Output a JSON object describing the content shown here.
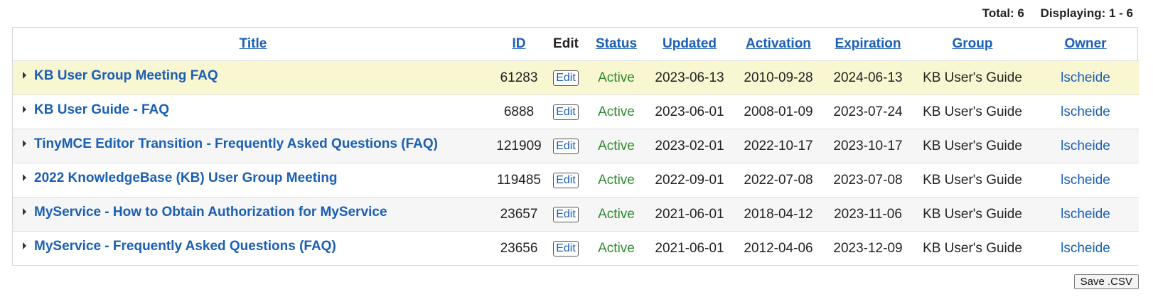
{
  "summary": {
    "total": "Total: 6",
    "displaying": "Displaying: 1 - 6"
  },
  "columns": {
    "title": "Title",
    "id": "ID",
    "edit": "Edit",
    "status": "Status",
    "updated": "Updated",
    "activation": "Activation",
    "expiration": "Expiration",
    "group": "Group",
    "owner": "Owner"
  },
  "rows": [
    {
      "title": "KB User Group Meeting FAQ",
      "id": "61283",
      "edit": "Edit",
      "status": "Active",
      "updated": "2023-06-13",
      "activation": "2010-09-28",
      "expiration": "2024-06-13",
      "group": "KB User's Guide",
      "owner": "lscheide"
    },
    {
      "title": "KB User Guide - FAQ",
      "id": "6888",
      "edit": "Edit",
      "status": "Active",
      "updated": "2023-06-01",
      "activation": "2008-01-09",
      "expiration": "2023-07-24",
      "group": "KB User's Guide",
      "owner": "lscheide"
    },
    {
      "title": "TinyMCE Editor Transition - Frequently Asked Questions (FAQ)",
      "id": "121909",
      "edit": "Edit",
      "status": "Active",
      "updated": "2023-02-01",
      "activation": "2022-10-17",
      "expiration": "2023-10-17",
      "group": "KB User's Guide",
      "owner": "lscheide"
    },
    {
      "title": "2022 KnowledgeBase (KB) User Group Meeting",
      "id": "119485",
      "edit": "Edit",
      "status": "Active",
      "updated": "2022-09-01",
      "activation": "2022-07-08",
      "expiration": "2023-07-08",
      "group": "KB User's Guide",
      "owner": "lscheide"
    },
    {
      "title": "MyService - How to Obtain Authorization for MyService",
      "id": "23657",
      "edit": "Edit",
      "status": "Active",
      "updated": "2021-06-01",
      "activation": "2018-04-12",
      "expiration": "2023-11-06",
      "group": "KB User's Guide",
      "owner": "lscheide"
    },
    {
      "title": "MyService - Frequently Asked Questions (FAQ)",
      "id": "23656",
      "edit": "Edit",
      "status": "Active",
      "updated": "2021-06-01",
      "activation": "2012-04-06",
      "expiration": "2023-12-09",
      "group": "KB User's Guide",
      "owner": "lscheide"
    }
  ],
  "footer": {
    "save_csv": "Save .CSV"
  },
  "colors": {
    "link": "#1a5fb4",
    "status_active": "#2e8b2e",
    "highlight_row": "#f9f6d2"
  }
}
